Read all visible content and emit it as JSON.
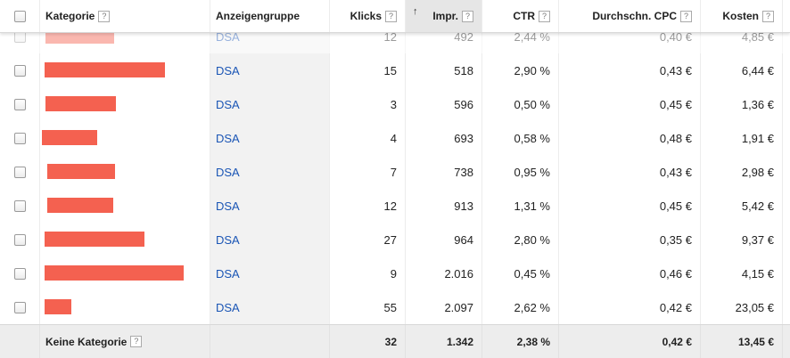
{
  "header": {
    "category": "Kategorie",
    "adgroup": "Anzeigengruppe",
    "clicks": "Klicks",
    "impressions": "Impr.",
    "sort_arrow": "↑",
    "ctr": "CTR",
    "avg_cpc": "Durchschn. CPC",
    "cost": "Kosten",
    "help_glyph": "?"
  },
  "rows": [
    {
      "adgroup": "DSA",
      "clicks": "12",
      "impr": "492",
      "ctr": "2,44 %",
      "cpc": "0,40 €",
      "cost": "4,85 €"
    },
    {
      "adgroup": "DSA",
      "clicks": "15",
      "impr": "518",
      "ctr": "2,90 %",
      "cpc": "0,43 €",
      "cost": "6,44 €"
    },
    {
      "adgroup": "DSA",
      "clicks": "3",
      "impr": "596",
      "ctr": "0,50 %",
      "cpc": "0,45 €",
      "cost": "1,36 €"
    },
    {
      "adgroup": "DSA",
      "clicks": "4",
      "impr": "693",
      "ctr": "0,58 %",
      "cpc": "0,48 €",
      "cost": "1,91 €"
    },
    {
      "adgroup": "DSA",
      "clicks": "7",
      "impr": "738",
      "ctr": "0,95 %",
      "cpc": "0,43 €",
      "cost": "2,98 €"
    },
    {
      "adgroup": "DSA",
      "clicks": "12",
      "impr": "913",
      "ctr": "1,31 %",
      "cpc": "0,45 €",
      "cost": "5,42 €"
    },
    {
      "adgroup": "DSA",
      "clicks": "27",
      "impr": "964",
      "ctr": "2,80 %",
      "cpc": "0,35 €",
      "cost": "9,37 €"
    },
    {
      "adgroup": "DSA",
      "clicks": "9",
      "impr": "2.016",
      "ctr": "0,45 %",
      "cpc": "0,46 €",
      "cost": "4,15 €"
    },
    {
      "adgroup": "DSA",
      "clicks": "55",
      "impr": "2.097",
      "ctr": "2,62 %",
      "cpc": "0,42 €",
      "cost": "23,05 €"
    }
  ],
  "footer": {
    "label": "Keine Kategorie",
    "clicks": "32",
    "impr": "1.342",
    "ctr": "2,38 %",
    "cpc": "0,42 €",
    "cost": "13,45 €"
  },
  "colors": {
    "redaction": "#f46150",
    "link": "#1a55b5",
    "sorted_column": "#e6e6e6"
  }
}
